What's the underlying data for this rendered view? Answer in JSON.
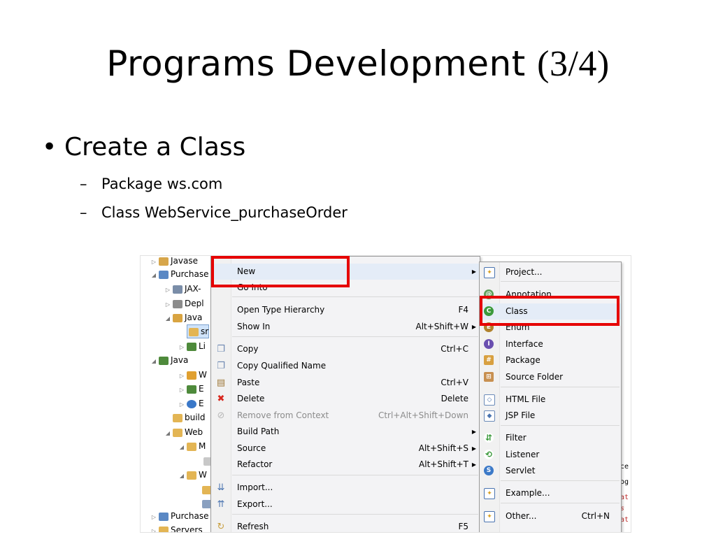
{
  "slide": {
    "title_text": "Programs Development ",
    "title_number": "(3/4)",
    "bullet": "Create a Class",
    "subbullets": [
      "Package ws.com",
      "Class WebService_purchaseOrder"
    ]
  },
  "tree": {
    "rows": [
      "Javase",
      "Purchase",
      "JAX-",
      "Depl",
      "Java",
      "sr",
      "Li",
      "Java",
      "W",
      "E",
      "E",
      "build",
      "Web",
      "M",
      "",
      "W",
      "",
      "",
      "Purchase",
      "Servers"
    ]
  },
  "context_menu": {
    "items": [
      {
        "label": "New",
        "shortcut": "",
        "submenu": true
      },
      {
        "label": "Go Into",
        "shortcut": ""
      },
      {
        "label": "Open Type Hierarchy",
        "shortcut": "F4"
      },
      {
        "label": "Show In",
        "shortcut": "Alt+Shift+W",
        "submenu": true
      },
      {
        "label": "Copy",
        "shortcut": "Ctrl+C"
      },
      {
        "label": "Copy Qualified Name",
        "shortcut": ""
      },
      {
        "label": "Paste",
        "shortcut": "Ctrl+V"
      },
      {
        "label": "Delete",
        "shortcut": "Delete"
      },
      {
        "label": "Remove from Context",
        "shortcut": "Ctrl+Alt+Shift+Down",
        "disabled": true
      },
      {
        "label": "Build Path",
        "shortcut": "",
        "submenu": true
      },
      {
        "label": "Source",
        "shortcut": "Alt+Shift+S",
        "submenu": true
      },
      {
        "label": "Refactor",
        "shortcut": "Alt+Shift+T",
        "submenu": true
      },
      {
        "label": "Import...",
        "shortcut": ""
      },
      {
        "label": "Export...",
        "shortcut": ""
      },
      {
        "label": "Refresh",
        "shortcut": "F5"
      }
    ]
  },
  "new_submenu": {
    "items": [
      {
        "label": "Project...",
        "shortcut": ""
      },
      {
        "label": "Annotation",
        "shortcut": ""
      },
      {
        "label": "Class",
        "shortcut": ""
      },
      {
        "label": "Enum",
        "shortcut": ""
      },
      {
        "label": "Interface",
        "shortcut": ""
      },
      {
        "label": "Package",
        "shortcut": ""
      },
      {
        "label": "Source Folder",
        "shortcut": ""
      },
      {
        "label": "HTML File",
        "shortcut": ""
      },
      {
        "label": "JSP File",
        "shortcut": ""
      },
      {
        "label": "Filter",
        "shortcut": ""
      },
      {
        "label": "Listener",
        "shortcut": ""
      },
      {
        "label": "Servlet",
        "shortcut": ""
      },
      {
        "label": "Example...",
        "shortcut": ""
      },
      {
        "label": "Other...",
        "shortcut": "Ctrl+N"
      }
    ]
  },
  "editor_fragments": [
    "ce",
    "og",
    "at",
    "s",
    "at"
  ],
  "colors": {
    "highlight_box": "#e60000"
  }
}
